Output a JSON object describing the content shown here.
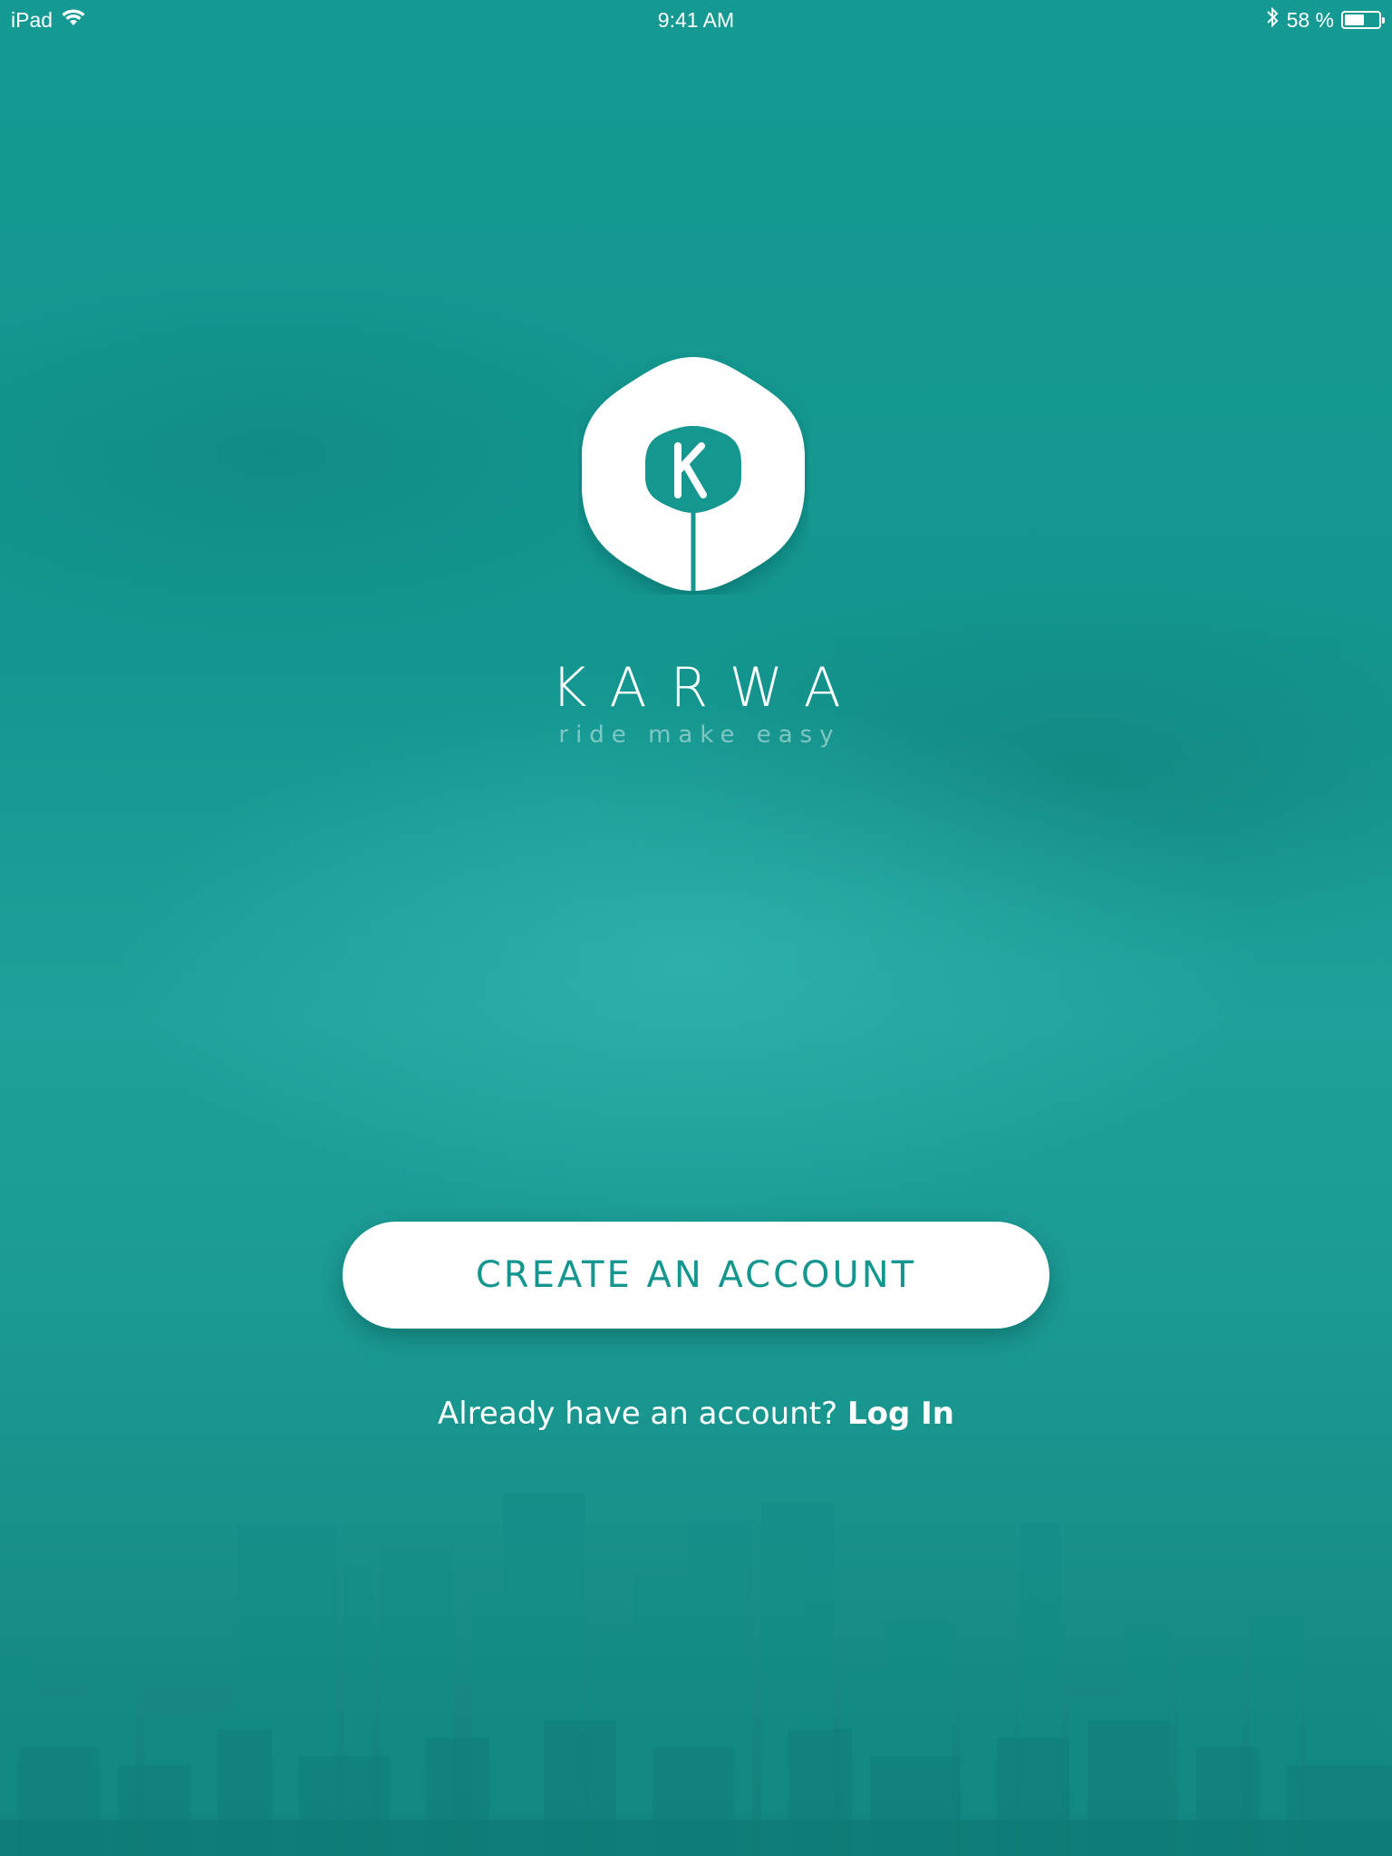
{
  "status_bar": {
    "device": "iPad",
    "time": "9:41 AM",
    "battery_text": "58 %",
    "battery_level": 0.58
  },
  "brand": {
    "logo_letter": "K",
    "name": "KARWA",
    "tagline": "ride make easy"
  },
  "actions": {
    "create_account": "CREATE AN ACCOUNT",
    "login_prompt": "Already have an account?",
    "login_link": "Log In"
  },
  "colors": {
    "accent": "#15968f",
    "background": "#149a92",
    "button_background": "#ffffff"
  },
  "icons": {
    "wifi": "wifi-icon",
    "bluetooth": "bluetooth-icon",
    "battery": "battery-icon",
    "logo": "karwa-logo-icon"
  }
}
